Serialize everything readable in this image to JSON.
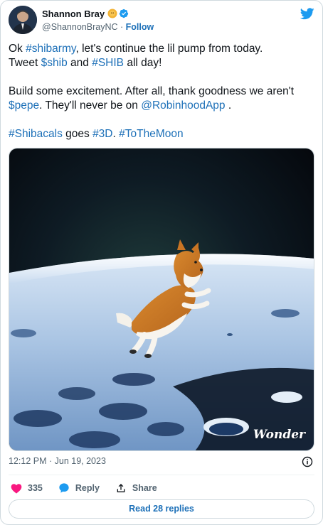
{
  "author": {
    "display_name": "Shannon Bray",
    "handle": "@ShannonBrayNC",
    "separator": "·",
    "follow_label": "Follow",
    "avatar_icon": "profile-photo",
    "badges": [
      "coin-badge-icon",
      "verified-icon"
    ]
  },
  "brand": {
    "logo": "twitter-bird-icon",
    "accent": "#1d9bf0",
    "link_color": "#1d70b8"
  },
  "tweet": {
    "line1": {
      "t1": "Ok ",
      "l1": "#shibarmy",
      "t2": ", let's continue the lil pump from today."
    },
    "line2": {
      "t1": "Tweet ",
      "l1": "$shib",
      "t2": " and ",
      "l2": "#SHIB",
      "t3": " all day!"
    },
    "line3": {
      "t1": "Build some excitement. After all, thank goodness we aren't"
    },
    "line4": {
      "l1": "$pepe",
      "t1": ". They'll never be on ",
      "l2": "@RobinhoodApp",
      "t2": " ."
    },
    "line5": {
      "l1": "#Shibacals",
      "t1": " goes ",
      "l2": "#3D",
      "t2": ". ",
      "l3": "#ToTheMoon"
    }
  },
  "media": {
    "watermark": "Wonder"
  },
  "timestamp": "12:12 PM · Jun 19, 2023",
  "actions": {
    "like_count": "335",
    "reply_label": "Reply",
    "share_label": "Share",
    "like_color": "#f91880"
  },
  "read_replies_label": "Read 28 replies"
}
